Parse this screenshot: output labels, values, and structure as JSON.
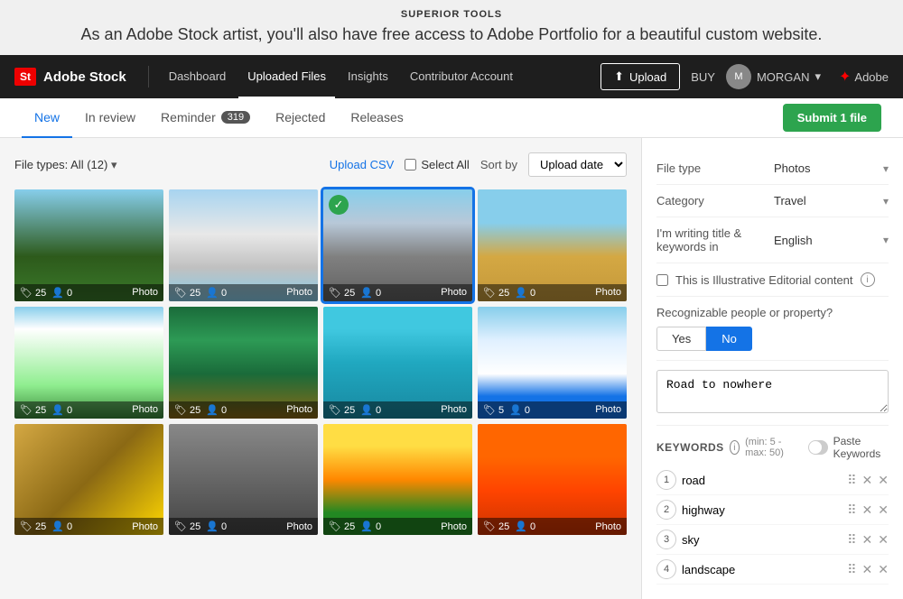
{
  "app": {
    "title": "SUPERIOR TOOLS",
    "tagline": "As an Adobe Stock artist, you'll also have free access to Adobe Portfolio for a beautiful custom website."
  },
  "navbar": {
    "logo_badge": "St",
    "brand_name": "Adobe Stock",
    "links": [
      {
        "label": "Dashboard",
        "active": false
      },
      {
        "label": "Uploaded Files",
        "active": true
      },
      {
        "label": "Insights",
        "active": false
      },
      {
        "label": "Contributor Account",
        "active": false
      }
    ],
    "upload_label": "Upload",
    "buy_label": "BUY",
    "user_name": "MORGAN",
    "adobe_label": "Adobe"
  },
  "tabs": {
    "items": [
      {
        "label": "New",
        "active": true,
        "badge": null
      },
      {
        "label": "In review",
        "active": false,
        "badge": null
      },
      {
        "label": "Reminder",
        "active": false,
        "badge": "319"
      },
      {
        "label": "Rejected",
        "active": false,
        "badge": null
      },
      {
        "label": "Releases",
        "active": false,
        "badge": null
      }
    ],
    "submit_button": "Submit 1 file"
  },
  "file_controls": {
    "file_type_label": "File types: All (12)",
    "upload_csv": "Upload CSV",
    "select_all": "Select All",
    "sort_label": "Sort by",
    "sort_value": "Upload date"
  },
  "images": [
    {
      "id": 1,
      "style": "img-trees",
      "tags": 25,
      "people": 0,
      "type": "Photo",
      "selected": false
    },
    {
      "id": 2,
      "style": "img-plane",
      "tags": 25,
      "people": 0,
      "type": "Photo",
      "selected": false
    },
    {
      "id": 3,
      "style": "img-road",
      "tags": 25,
      "people": 0,
      "type": "Photo",
      "selected": true
    },
    {
      "id": 4,
      "style": "img-desert",
      "tags": 25,
      "people": 0,
      "type": "Photo",
      "selected": false
    },
    {
      "id": 5,
      "style": "img-sky-field",
      "tags": 25,
      "people": 0,
      "type": "Photo",
      "selected": false
    },
    {
      "id": 6,
      "style": "img-palm",
      "tags": 25,
      "people": 0,
      "type": "Photo",
      "selected": false
    },
    {
      "id": 7,
      "style": "img-float",
      "tags": 25,
      "people": 0,
      "type": "Photo",
      "selected": false
    },
    {
      "id": 8,
      "style": "img-ski",
      "tags": 5,
      "people": 0,
      "type": "Photo",
      "selected": false
    },
    {
      "id": 9,
      "style": "img-interior",
      "tags": 25,
      "people": 0,
      "type": "Photo",
      "selected": false
    },
    {
      "id": 10,
      "style": "img-urban",
      "tags": 25,
      "people": 0,
      "type": "Photo",
      "selected": false
    },
    {
      "id": 11,
      "style": "img-flowers",
      "tags": 25,
      "people": 0,
      "type": "Photo",
      "selected": false
    },
    {
      "id": 12,
      "style": "img-animal",
      "tags": 25,
      "people": 0,
      "type": "Photo",
      "selected": false
    }
  ],
  "right_panel": {
    "file_type_label": "File type",
    "file_type_value": "Photos",
    "category_label": "Category",
    "category_value": "Travel",
    "lang_label": "I'm writing title & keywords in",
    "lang_value": "English",
    "editorial_label": "This is Illustrative Editorial content",
    "people_label": "Recognizable people or property?",
    "yes_label": "Yes",
    "no_label": "No",
    "title_placeholder": "Road to nowhere",
    "keywords_label": "KEYWORDS",
    "keywords_hint": "min: 5 - max: 50",
    "paste_label": "Paste Keywords",
    "keywords": [
      {
        "num": 1,
        "value": "road"
      },
      {
        "num": 2,
        "value": "highway"
      },
      {
        "num": 3,
        "value": "sky"
      },
      {
        "num": 4,
        "value": "landscape"
      }
    ]
  }
}
